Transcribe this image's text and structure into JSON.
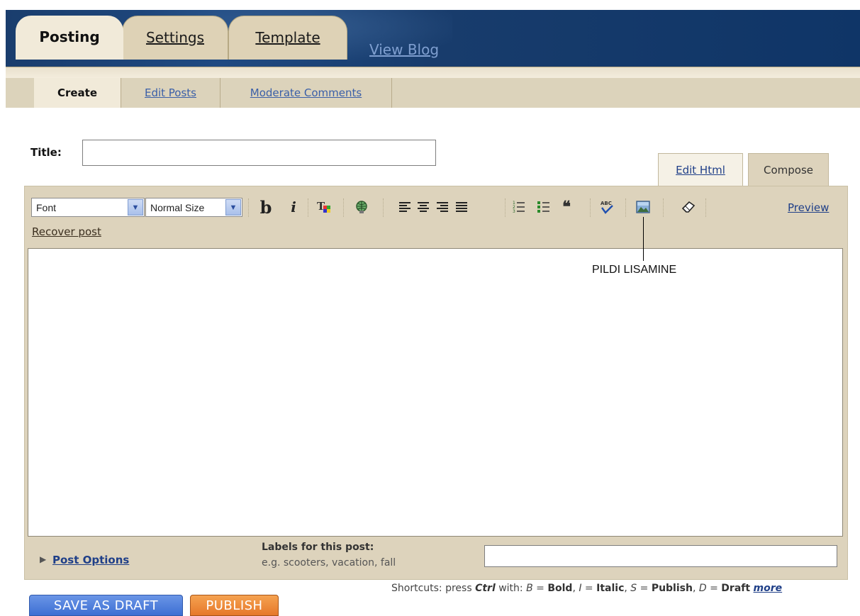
{
  "nav": {
    "tabs": [
      {
        "label": "Posting"
      },
      {
        "label": "Settings"
      },
      {
        "label": "Template"
      },
      {
        "label": "View Blog"
      }
    ],
    "subtabs": [
      {
        "label": "Create"
      },
      {
        "label": "Edit Posts"
      },
      {
        "label": "Moderate Comments"
      }
    ]
  },
  "title": {
    "label": "Title:",
    "value": ""
  },
  "modes": {
    "edit_html": "Edit Html",
    "compose": "Compose"
  },
  "toolbar": {
    "font": "Font",
    "size": "Normal Size",
    "bold": "b",
    "italic": "i",
    "preview": "Preview",
    "recover": "Recover post",
    "icons": [
      "text-color-icon",
      "link-icon",
      "align-left-icon",
      "align-center-icon",
      "align-right-icon",
      "justify-icon",
      "numbered-list-icon",
      "bullet-list-icon",
      "blockquote-icon",
      "spellcheck-icon",
      "add-image-icon",
      "remove-formatting-icon"
    ]
  },
  "editor": {
    "body": ""
  },
  "annotation": "PILDI LISAMINE",
  "bottom": {
    "post_options": "Post Options",
    "labels_title": "Labels for this post:",
    "labels_hint": "e.g. scooters, vacation, fall",
    "labels_value": ""
  },
  "shortcuts": {
    "prefix": "Shortcuts: press ",
    "ctrl": "Ctrl",
    "with": " with: ",
    "b_key": "B",
    "b_eq": " = ",
    "b_val": "Bold",
    "i_key": "I",
    "i_val": "Italic",
    "s_key": "S",
    "s_val": "Publish",
    "d_key": "D",
    "d_val": "Draft",
    "more": "more"
  },
  "buttons": {
    "save_draft": "SAVE AS DRAFT",
    "publish": "PUBLISH"
  },
  "colors": {
    "brand_blue": "#1a3d6d",
    "panel": "#ddd3bc",
    "draft_button": "#3d6fd3",
    "publish_button": "#e6782a"
  }
}
